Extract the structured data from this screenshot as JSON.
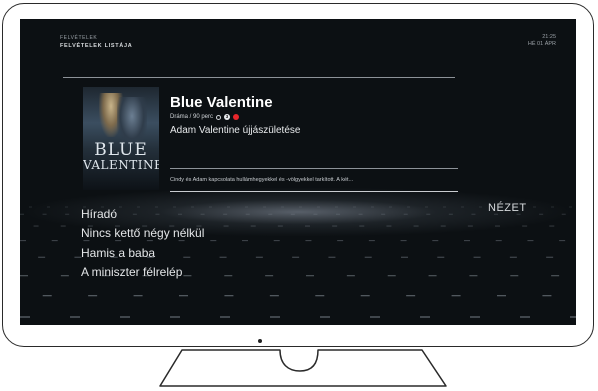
{
  "header": {
    "breadcrumb_parent": "FELVÉTELEK",
    "breadcrumb_current": "FELVÉTELEK LISTÁJA",
    "time": "21:25",
    "date": "HÉ 01 ÁPR"
  },
  "selected_recording": {
    "poster": {
      "title_line1": "BLUE",
      "title_line2": "VALENTINE"
    },
    "title": "Blue Valentine",
    "genre_duration": "Dráma / 90 perc",
    "episode_badge": "3",
    "subtitle": "Adam Valentine újjászületése",
    "description": "Cindy és Adam kapcsolata hullámhegyekkel és -völgyekkel tarkított. A két..."
  },
  "recordings_list": [
    {
      "label": "Híradó"
    },
    {
      "label": "Nincs kettő négy nélkül"
    },
    {
      "label": "Hamis a baba"
    },
    {
      "label": "A miniszter félrelép"
    }
  ],
  "view_button": {
    "label": "NÉZET"
  },
  "icons": {
    "duration": "clock-icon",
    "episode": "episode-number-icon",
    "recording": "record-dot-icon"
  },
  "colors": {
    "screen_background": "#0c1013",
    "record_red": "#e8262b",
    "text_primary": "#ffffff"
  }
}
